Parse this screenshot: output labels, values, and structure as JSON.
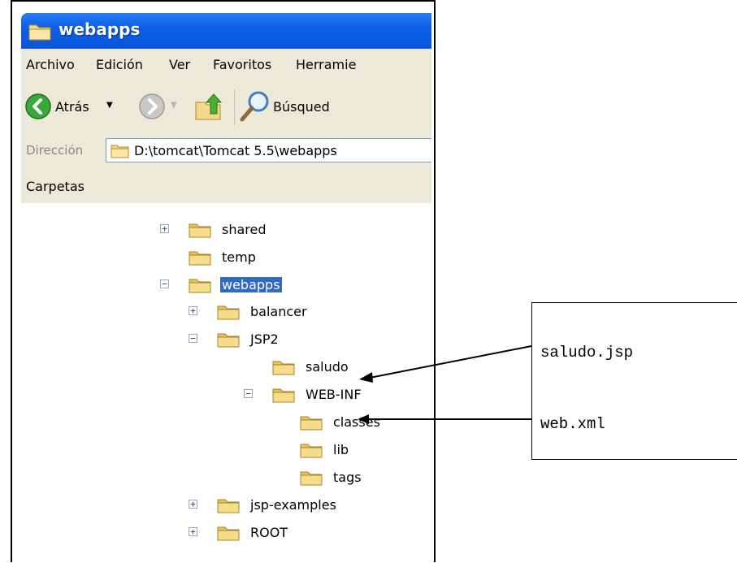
{
  "window": {
    "title": "webapps",
    "menu": [
      "Archivo",
      "Edición",
      "Ver",
      "Favoritos",
      "Herramie"
    ],
    "toolbar": {
      "back_label": "Atrás",
      "search_label": "Búsqued"
    },
    "address": {
      "label": "Dirección",
      "value": "D:\\tomcat\\Tomcat 5.5\\webapps"
    },
    "folders_pane_label": "Carpetas"
  },
  "tree": [
    {
      "label": "shared",
      "toggle": "+"
    },
    {
      "label": "temp"
    },
    {
      "label": "webapps",
      "toggle": "−",
      "selected": true
    },
    {
      "label": "balancer",
      "toggle": "+"
    },
    {
      "label": "JSP2",
      "toggle": "−"
    },
    {
      "label": "saludo"
    },
    {
      "label": "WEB-INF",
      "toggle": "−"
    },
    {
      "label": "classes"
    },
    {
      "label": "lib"
    },
    {
      "label": "tags"
    },
    {
      "label": "jsp-examples",
      "toggle": "+"
    },
    {
      "label": "ROOT",
      "toggle": "+"
    }
  ],
  "callout": {
    "line1": "saludo.jsp",
    "line2": "web.xml"
  },
  "colors": {
    "title_bar": "#0c5fe6",
    "selection": "#316ac5",
    "chrome": "#ece9d8",
    "folder": "#f5d67a"
  }
}
